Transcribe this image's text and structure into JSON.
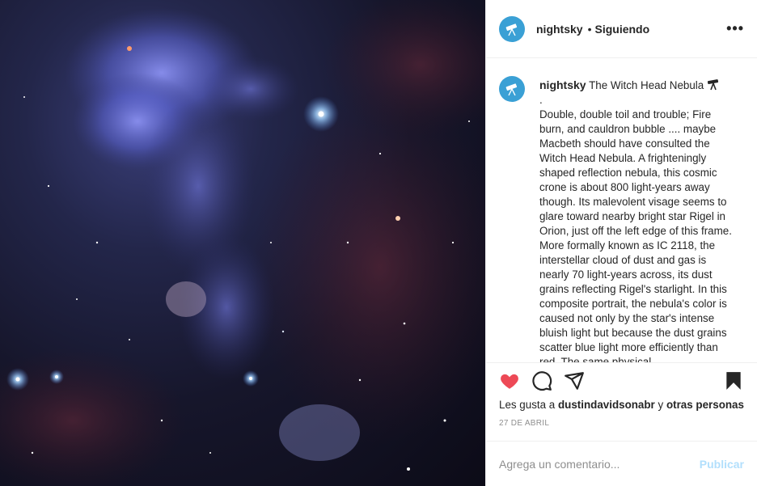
{
  "post": {
    "author": {
      "username": "nightsky",
      "follow_status": "Siguiendo",
      "avatar_icon": "telescope-icon"
    },
    "more_icon": "more-options-icon",
    "caption": {
      "username": "nightsky",
      "title": "The Witch Head Nebula",
      "emoji_icon": "telescope-icon",
      "separator": ".",
      "text": "Double, double toil and trouble; Fire burn, and cauldron bubble .... maybe Macbeth should have consulted the Witch Head Nebula. A frighteningly shaped reflection nebula, this cosmic crone is about 800 light-years away though. Its malevolent visage seems to glare toward nearby bright star Rigel in Orion, just off the left edge of this frame. More formally known as IC 2118, the interstellar cloud of dust and gas is nearly 70 light-years across, its dust grains reflecting Rigel's starlight. In this composite portrait, the nebula's color is caused not only by the star's intense bluish light but because the dust grains scatter blue light more efficiently than red. The same physical"
    },
    "actions": {
      "like_icon": "heart-icon",
      "comment_icon": "comment-icon",
      "share_icon": "share-icon",
      "save_icon": "bookmark-icon"
    },
    "likes": {
      "prefix": "Les gusta a",
      "user": "dustindavidsonabr",
      "conjunction": "y",
      "others": "otras personas"
    },
    "date": "27 DE ABRIL",
    "comment_box": {
      "placeholder": "Agrega un comentario...",
      "publish_label": "Publicar"
    },
    "colors": {
      "like": "#ed4956",
      "publish_disabled": "#b2dffc",
      "avatar_bg": "#3aa0d5",
      "nebula": "#6a73d8"
    }
  }
}
